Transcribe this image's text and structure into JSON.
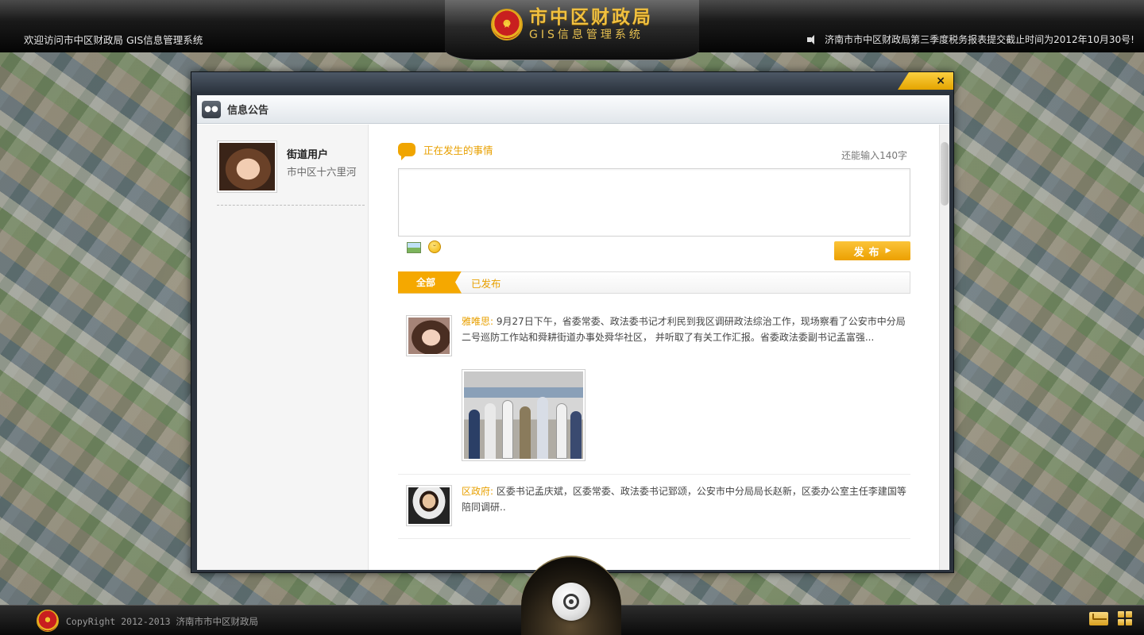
{
  "header": {
    "welcome": "欢迎访问市中区财政局 GIS信息管理系统",
    "brand_title": "市中区财政局",
    "brand_subtitle": "GIS信息管理系统",
    "notice": "济南市市中区财政局第三季度税务报表提交截止时间为2012年10月30号!",
    "emblem_icon": "national-emblem-icon",
    "speaker_icon": "speaker-icon"
  },
  "dialog": {
    "close_label": "×",
    "panel_title": "信息公告",
    "accent_color": "#f5a800"
  },
  "sidebar": {
    "user_name": "街道用户",
    "user_area": "市中区十六里河"
  },
  "compose": {
    "label": "正在发生的事情",
    "char_count": "还能输入140字",
    "placeholder": "",
    "publish_label": "发布",
    "publish_arrow": "▶"
  },
  "tabs": [
    {
      "label": "全部",
      "active": true
    },
    {
      "label": "已发布",
      "active": false
    }
  ],
  "feed": [
    {
      "author": "雅唯思:",
      "text": "9月27日下午，省委常委、政法委书记才利民到我区调研政法综治工作，现场察看了公安市中分局二号巡防工作站和舜耕街道办事处舜华社区，  并听取了有关工作汇报。省委政法委副书记孟富强..."
    },
    {
      "author": "区政府:",
      "text": "区委书记孟庆斌，区委常委、政法委书记郅颂，公安市中分局局长赵新，区委办公室主任李建国等陪同调研.."
    }
  ],
  "footer": {
    "copyright": "CopyRight 2012-2013 济南市市中区财政局"
  }
}
